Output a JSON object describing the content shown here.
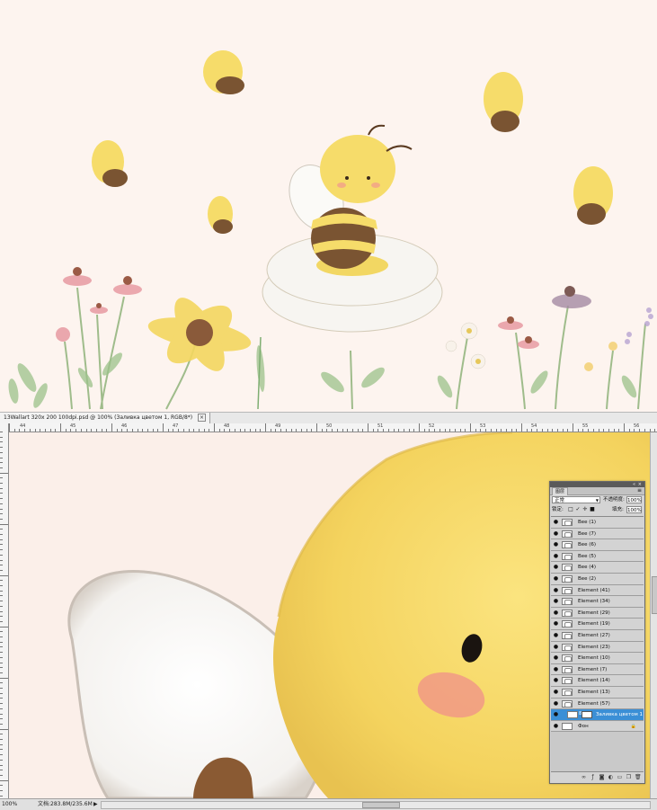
{
  "document": {
    "tab_title": "13Wallart 320x 200 100dpi.psd @ 100% (Заливка цветом 1, RGB/8*)",
    "tab_close": "×",
    "zoom": "100%",
    "doc_size": "文档:283.8M/235.6M",
    "ruler_labels": [
      "44",
      "45",
      "46",
      "47",
      "48",
      "49",
      "50",
      "51",
      "52",
      "53",
      "54",
      "55",
      "56"
    ]
  },
  "layers_panel": {
    "tab_label": "图层",
    "menu_icon": "menu-icon",
    "blend_mode": "正常",
    "opacity_label": "不透明度:",
    "opacity_value": "100%",
    "lock_label": "锁定:",
    "fill_label": "填充:",
    "fill_value": "100%",
    "layers": [
      {
        "name": "Bee (1)"
      },
      {
        "name": "Bee (7)"
      },
      {
        "name": "Bee (6)"
      },
      {
        "name": "Bee (5)"
      },
      {
        "name": "Bee (4)"
      },
      {
        "name": "Bee (2)"
      },
      {
        "name": "Element (41)"
      },
      {
        "name": "Element (34)"
      },
      {
        "name": "Element (29)"
      },
      {
        "name": "Element (19)"
      },
      {
        "name": "Element (27)"
      },
      {
        "name": "Element (23)"
      },
      {
        "name": "Element (10)"
      },
      {
        "name": "Element (7)"
      },
      {
        "name": "Element (14)"
      },
      {
        "name": "Element (13)"
      },
      {
        "name": "Element (57)"
      },
      {
        "name": "Заливка цветом 1"
      },
      {
        "name": "Фон"
      }
    ]
  },
  "colors": {
    "background": "#fdf4ef",
    "bee_yellow": "#f6dc6a",
    "bee_brown": "#7a5432",
    "selection_blue": "#3b8fd6"
  }
}
